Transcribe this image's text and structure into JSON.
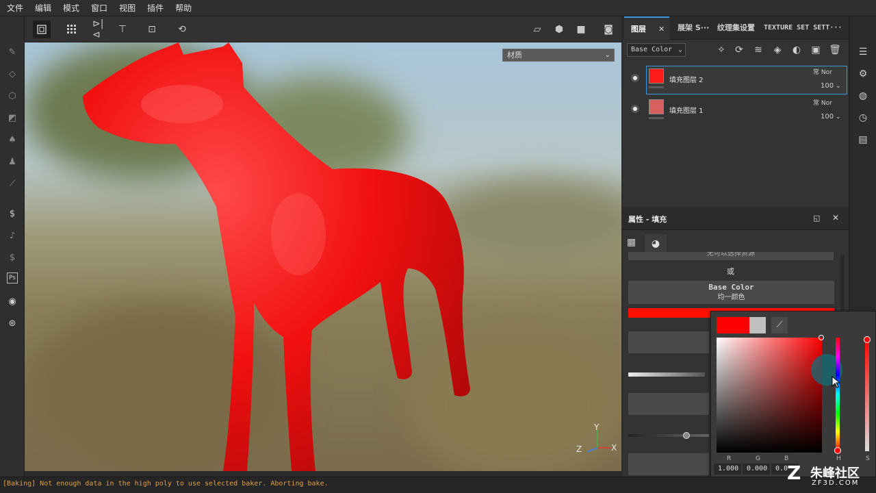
{
  "menu": [
    "文件",
    "编辑",
    "模式",
    "窗口",
    "视图",
    "插件",
    "帮助"
  ],
  "viewport": {
    "material_select": "材质",
    "axis_labels": {
      "y": "Y",
      "z": "Z",
      "x": "X"
    }
  },
  "layers_panel": {
    "tabs": [
      {
        "label": "图层",
        "active": true
      },
      {
        "label": "展架 S···",
        "active": false
      },
      {
        "label": "纹理集设置",
        "active": false
      },
      {
        "label": "TEXTURE SET SETT···",
        "active": false
      }
    ],
    "blend_channel": "Base Color",
    "layers": [
      {
        "name": "填充图层 2",
        "blend": "常 Nor",
        "opacity": "100",
        "color": "#ff1a1a",
        "selected": true
      },
      {
        "name": "填充图层 1",
        "blend": "常 Nor",
        "opacity": "100",
        "color": "#d96060",
        "selected": false
      }
    ]
  },
  "properties": {
    "title": "属性 - 填充",
    "hidden_label": "无可以选择资源",
    "or_label": "或",
    "base_color_label": "Base Color",
    "uniform_color_label": "均一颜色",
    "fill_color": "#ff1000"
  },
  "color_picker": {
    "current_color": "#ff0000",
    "previous_color": "#c0c0c0",
    "channels": [
      {
        "label": "R",
        "value": "1.000"
      },
      {
        "label": "G",
        "value": "0.000"
      },
      {
        "label": "B",
        "value": "0.0"
      }
    ],
    "h_label": "H",
    "s_label": "S"
  },
  "status": {
    "message": "[Baking] Not enough data in the high poly to use selected baker. Aborting bake."
  },
  "watermark": {
    "brand": "朱峰社区",
    "domain": "ZF3D.COM"
  }
}
